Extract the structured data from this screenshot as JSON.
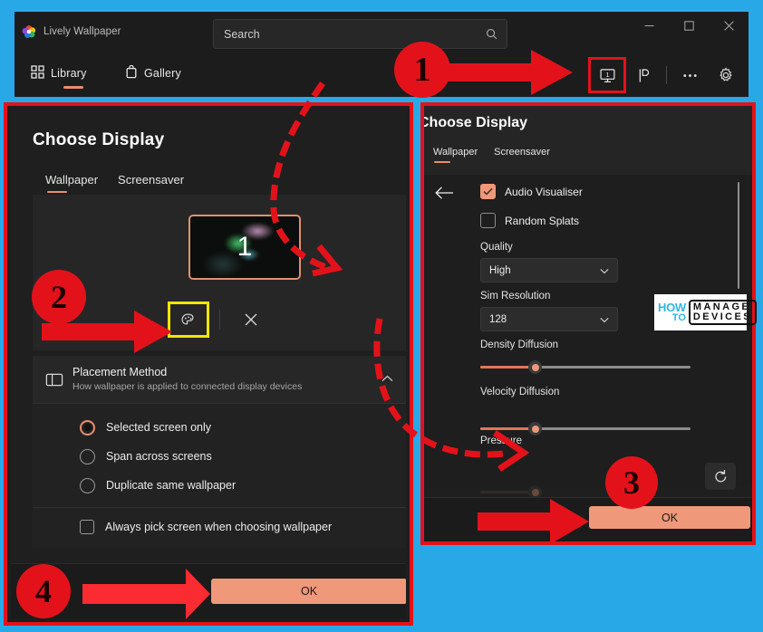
{
  "app": {
    "title": "Lively Wallpaper",
    "logo_icon": "lively-flower-logo",
    "search": {
      "value": "Search",
      "placeholder": "Search",
      "icon": "search-icon"
    },
    "window_controls": [
      {
        "name": "minimize",
        "icon": "minimize-icon"
      },
      {
        "name": "maximize",
        "icon": "maximize-icon"
      },
      {
        "name": "close",
        "icon": "close-icon"
      }
    ],
    "nav": [
      {
        "label": "Library",
        "icon": "grid-icon",
        "active": true
      },
      {
        "label": "Gallery",
        "icon": "store-bag-icon",
        "active": false
      }
    ],
    "toolbar": [
      {
        "name": "choose-display",
        "icon": "monitor-1-icon",
        "highlighted": true
      },
      {
        "name": "performance",
        "icon": "flag-pause-icon",
        "highlighted": false
      },
      {
        "name": "more",
        "icon": "ellipsis-icon",
        "highlighted": false
      },
      {
        "name": "settings",
        "icon": "gear-icon",
        "highlighted": false
      }
    ]
  },
  "left_dialog": {
    "title": "Choose Display",
    "tabs": [
      {
        "label": "Wallpaper",
        "active": true
      },
      {
        "label": "Screensaver",
        "active": false
      }
    ],
    "screen": {
      "number": "1",
      "customize_icon": "palette-icon",
      "close_icon": "close-x-icon"
    },
    "expander": {
      "icon": "layout-icon",
      "title": "Placement Method",
      "subtitle": "How wallpaper is applied to connected display devices",
      "chevron": "chevron-up-icon"
    },
    "radios": [
      {
        "label": "Selected screen only",
        "selected": true
      },
      {
        "label": "Span across screens",
        "selected": false
      },
      {
        "label": "Duplicate same wallpaper",
        "selected": false
      }
    ],
    "checkbox": {
      "label": "Always pick screen when choosing wallpaper",
      "checked": false
    },
    "ok_label": "OK"
  },
  "right_dialog": {
    "title": "Choose Display",
    "tabs": [
      {
        "label": "Wallpaper",
        "active": true
      },
      {
        "label": "Screensaver",
        "active": false
      }
    ],
    "back_icon": "back-arrow-icon",
    "checkboxes": [
      {
        "label": "Audio Visualiser",
        "checked": true
      },
      {
        "label": "Random Splats",
        "checked": false
      }
    ],
    "quality": {
      "label": "Quality",
      "value": "High",
      "chevron": "chevron-down-icon"
    },
    "sim_resolution": {
      "label": "Sim Resolution",
      "value": "128",
      "chevron": "chevron-down-icon"
    },
    "sliders": [
      {
        "label": "Density Diffusion",
        "percent": 26
      },
      {
        "label": "Velocity Diffusion",
        "percent": 26
      },
      {
        "label": "Pressure",
        "percent": 26
      }
    ],
    "reset_icon": "reset-icon",
    "ok_label": "OK"
  },
  "watermark": {
    "line1": "HOW",
    "line2": "TO",
    "line3": "MANAGE",
    "line4": "DEVICES"
  },
  "annotations": {
    "badges": [
      "1",
      "2",
      "3",
      "4"
    ],
    "accent_red": "#e3121a",
    "accent_yellow": "#f2e505",
    "accent_orange": "#f0987a",
    "page_background": "#29a8e8"
  }
}
